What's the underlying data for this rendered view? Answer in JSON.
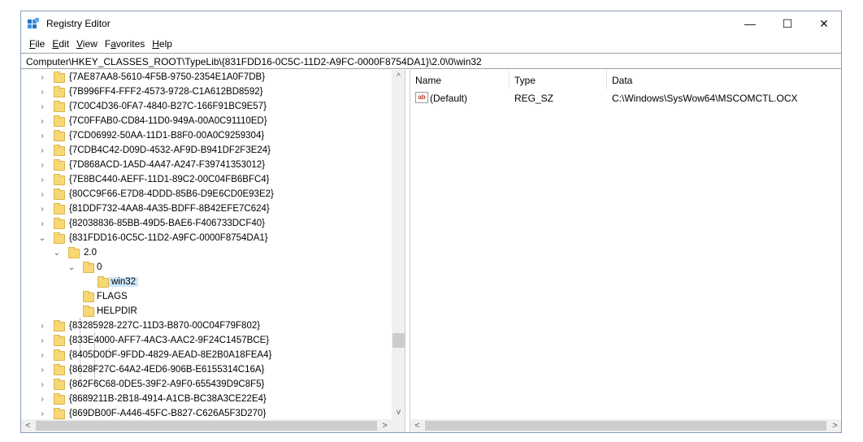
{
  "window": {
    "title": "Registry Editor",
    "controls": {
      "minimize": "—",
      "maximize": "☐",
      "close": "✕"
    }
  },
  "menu": [
    {
      "label": "File",
      "key": "F",
      "rest": "ile"
    },
    {
      "label": "Edit",
      "key": "E",
      "rest": "dit"
    },
    {
      "label": "View",
      "key": "V",
      "rest": "iew"
    },
    {
      "label": "Favorites",
      "key": "",
      "pre": "F",
      "keymid": "a",
      "post": "vorites"
    },
    {
      "label": "Help",
      "key": "H",
      "rest": "elp"
    }
  ],
  "address": "Computer\\HKEY_CLASSES_ROOT\\TypeLib\\{831FDD16-0C5C-11D2-A9FC-0000F8754DA1}\\2.0\\0\\win32",
  "tree": {
    "items": [
      {
        "label": "{7AE87AA8-5610-4F5B-9750-2354E1A0F7DB}",
        "level": 0,
        "arrow": "›"
      },
      {
        "label": "{7B996FF4-FFF2-4573-9728-C1A612BD8592}",
        "level": 0,
        "arrow": "›"
      },
      {
        "label": "{7C0C4D36-0FA7-4840-B27C-166F91BC9E57}",
        "level": 0,
        "arrow": "›"
      },
      {
        "label": "{7C0FFAB0-CD84-11D0-949A-00A0C91110ED}",
        "level": 0,
        "arrow": "›"
      },
      {
        "label": "{7CD06992-50AA-11D1-B8F0-00A0C9259304}",
        "level": 0,
        "arrow": "›"
      },
      {
        "label": "{7CDB4C42-D09D-4532-AF9D-B941DF2F3E24}",
        "level": 0,
        "arrow": "›"
      },
      {
        "label": "{7D868ACD-1A5D-4A47-A247-F39741353012}",
        "level": 0,
        "arrow": "›"
      },
      {
        "label": "{7E8BC440-AEFF-11D1-89C2-00C04FB6BFC4}",
        "level": 0,
        "arrow": "›"
      },
      {
        "label": "{80CC9F66-E7D8-4DDD-85B6-D9E6CD0E93E2}",
        "level": 0,
        "arrow": "›"
      },
      {
        "label": "{81DDF732-4AA8-4A35-BDFF-8B42EFE7C624}",
        "level": 0,
        "arrow": "›"
      },
      {
        "label": "{82038836-85BB-49D5-BAE6-F406733DCF40}",
        "level": 0,
        "arrow": "›"
      },
      {
        "label": "{831FDD16-0C5C-11D2-A9FC-0000F8754DA1}",
        "level": 0,
        "arrow": "⌄"
      },
      {
        "label": "2.0",
        "level": 1,
        "arrow": "⌄"
      },
      {
        "label": "0",
        "level": 2,
        "arrow": "⌄"
      },
      {
        "label": "win32",
        "level": 3,
        "arrow": "",
        "selected": true
      },
      {
        "label": "FLAGS",
        "level": 2,
        "arrow": ""
      },
      {
        "label": "HELPDIR",
        "level": 2,
        "arrow": ""
      },
      {
        "label": "{83285928-227C-11D3-B870-00C04F79F802}",
        "level": 0,
        "arrow": "›"
      },
      {
        "label": "{833E4000-AFF7-4AC3-AAC2-9F24C1457BCE}",
        "level": 0,
        "arrow": "›"
      },
      {
        "label": "{8405D0DF-9FDD-4829-AEAD-8E2B0A18FEA4}",
        "level": 0,
        "arrow": "›"
      },
      {
        "label": "{8628F27C-64A2-4ED6-906B-E6155314C16A}",
        "level": 0,
        "arrow": "›"
      },
      {
        "label": "{862F6C68-0DE5-39F2-A9F0-655439D9C8F5}",
        "level": 0,
        "arrow": "›"
      },
      {
        "label": "{8689211B-2B18-4914-A1CB-BC38A3CE22E4}",
        "level": 0,
        "arrow": "›"
      },
      {
        "label": "{869DB00F-A446-45FC-B827-C626A5F3D270}",
        "level": 0,
        "arrow": "›"
      }
    ]
  },
  "scroll": {
    "up": "^",
    "down": "v",
    "left": "<",
    "right": ">"
  },
  "values": {
    "headers": {
      "name": "Name",
      "type": "Type",
      "data": "Data"
    },
    "rows": [
      {
        "icon": "ab",
        "name": "(Default)",
        "type": "REG_SZ",
        "data": "C:\\Windows\\SysWow64\\MSCOMCTL.OCX"
      }
    ]
  }
}
